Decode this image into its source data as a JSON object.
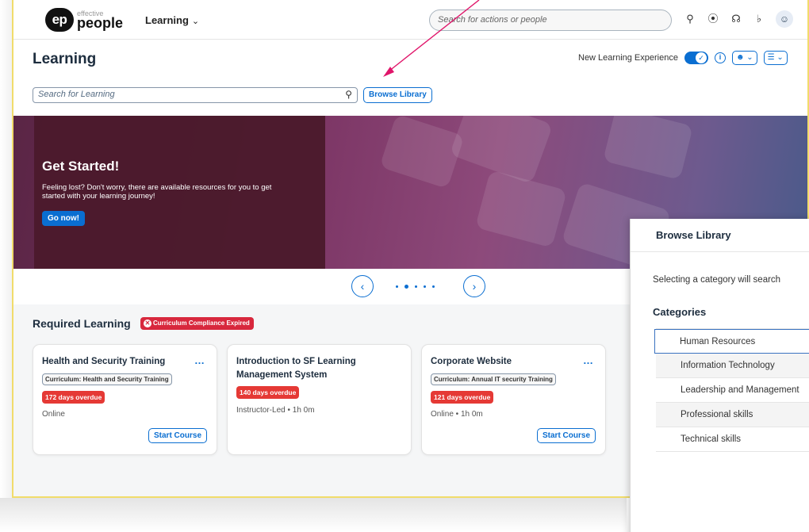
{
  "topbar": {
    "logo_mark": "ep",
    "logo_small": "effective",
    "logo_big": "people",
    "nav_label": "Learning",
    "search_placeholder": "Search for actions or people"
  },
  "page": {
    "title": "Learning",
    "new_experience_label": "New Learning Experience",
    "search_placeholder": "Search for Learning",
    "browse_button": "Browse Library"
  },
  "banner": {
    "title": "Get Started!",
    "text": "Feeling lost? Don't worry, there are available resources for you to get started with your learning journey!",
    "button": "Go now!"
  },
  "required": {
    "title": "Required Learning",
    "badge": "Curriculum Compliance Expired",
    "cards": [
      {
        "title": "Health and Security Training",
        "tag": "Curriculum: Health and Security Training",
        "overdue": "172 days overdue",
        "meta": "Online",
        "button": "Start Course"
      },
      {
        "title": "Introduction to SF Learning Management System",
        "tag": "",
        "overdue": "140 days overdue",
        "meta": "Instructor-Led • 1h 0m",
        "button": ""
      },
      {
        "title": "Corporate Website",
        "tag": "Curriculum: Annual IT security Training",
        "overdue": "121 days overdue",
        "meta": "Online • 1h 0m",
        "button": "Start Course"
      }
    ]
  },
  "panel": {
    "title": "Browse Library",
    "description": "Selecting a category will search",
    "categories_label": "Categories",
    "categories": [
      "Human Resources",
      "Information Technology",
      "Leadership and Management",
      "Professional skills",
      "Technical skills"
    ]
  },
  "colors": {
    "accent": "#0a6ed1",
    "danger": "#e53935",
    "arrow": "#e0156a"
  }
}
